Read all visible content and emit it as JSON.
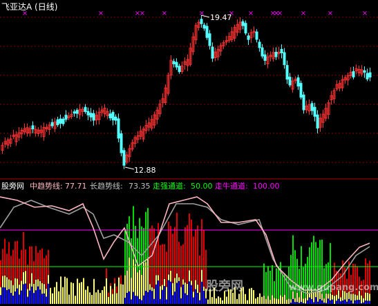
{
  "header": {
    "title": "飞亚达A (日线)"
  },
  "price_panel": {
    "high_label": "19.47",
    "low_label": "12.88"
  },
  "indicator_panel": {
    "site_label": "股旁网",
    "mid_trend_label": "中趋势线:",
    "mid_trend_value": "77.71",
    "long_trend_label": "长趋势线:",
    "long_trend_value": "73.35",
    "strong_channel_label": "走强通道:",
    "strong_channel_value": "50.00",
    "bull_channel_label": "走牛通道:",
    "bull_channel_value": "100.00"
  },
  "watermark": {
    "text_cn": "股旁网",
    "text_en": "www.gupang.com"
  },
  "colors": {
    "up": "#ff3232",
    "down": "#54ffff",
    "grid": "#8b0000",
    "mid_trend": "#ffb6c1",
    "long_trend": "#a0a0a0",
    "strong_channel": "#00ff00",
    "bull_channel": "#ff00ff",
    "label_gray": "#c0c0c0",
    "bar_red": "#e00000",
    "bar_green": "#00e000",
    "bar_yellow": "#ffff60",
    "bar_blue": "#1010ff",
    "marker": "#ff00ff"
  }
}
